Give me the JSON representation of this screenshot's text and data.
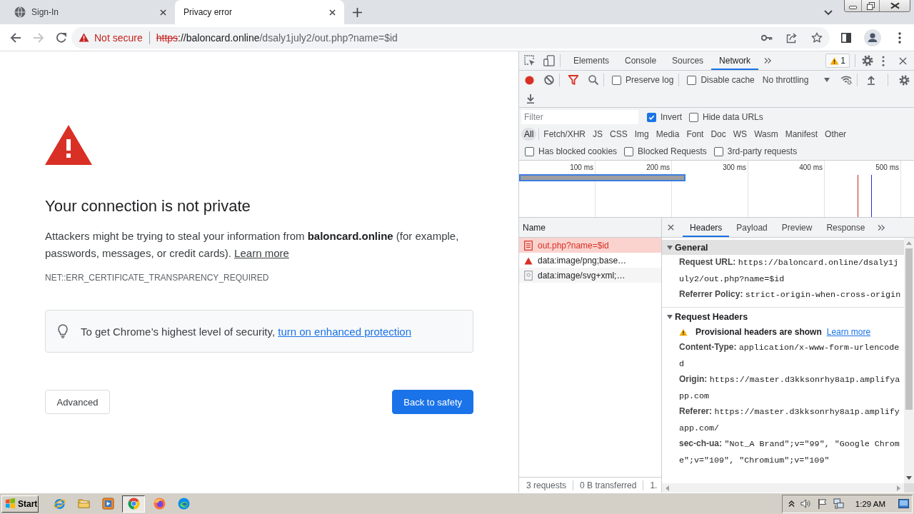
{
  "browser": {
    "tabs": [
      {
        "title": "Sign-In",
        "kind": "globe",
        "selected": false
      },
      {
        "title": "Privacy error",
        "selected": true
      }
    ],
    "nav": [
      {
        "kind": "back",
        "disabled": false
      },
      {
        "kind": "forward",
        "disabled": true
      },
      {
        "kind": "reload",
        "disabled": false
      }
    ],
    "address_bar": {
      "secure": false,
      "security_label": "Not secure",
      "scheme": "https",
      "host": "://baloncard.online",
      "path": "/dsaly1july2/out.php?name=$id"
    }
  },
  "page": {
    "heading": "Your connection is not private",
    "paragraph": {
      "text": "Attackers might be trying to steal your information from **baloncard.online** (for example, passwords, messages, or credit cards).",
      "link": "Learn more"
    },
    "error_code": "NET::ERR_CERTIFICATE_TRANSPARENCY_REQUIRED",
    "tip": {
      "text": "To get Chrome’s highest level of security,",
      "link": "turn on enhanced protection"
    },
    "buttons": [
      {
        "label": "Advanced",
        "kind": "secondary"
      },
      {
        "label": "Back to safety",
        "kind": "primary"
      }
    ]
  },
  "devtools": {
    "tabs": [
      {
        "label": "Elements",
        "selected": false
      },
      {
        "label": "Console",
        "selected": false
      },
      {
        "label": "Sources",
        "selected": false
      },
      {
        "label": "Network",
        "selected": true
      }
    ],
    "issues_count": "1",
    "recording": true,
    "filter_active": true,
    "options": [
      {
        "label": "Preserve log",
        "checked": false
      },
      {
        "label": "Disable cache",
        "checked": false
      }
    ],
    "throttling": "No throttling",
    "filter": {
      "placeholder": "Filter",
      "options": [
        {
          "label": "Invert",
          "checked": true
        },
        {
          "label": "Hide data URLs",
          "checked": false
        }
      ]
    },
    "type_filters": [
      {
        "label": "All",
        "selected": true
      },
      {
        "label": "Fetch/XHR",
        "selected": false
      },
      {
        "label": "JS",
        "selected": false
      },
      {
        "label": "CSS",
        "selected": false
      },
      {
        "label": "Img",
        "selected": false
      },
      {
        "label": "Media",
        "selected": false
      },
      {
        "label": "Font",
        "selected": false
      },
      {
        "label": "Doc",
        "selected": false
      },
      {
        "label": "WS",
        "selected": false
      },
      {
        "label": "Wasm",
        "selected": false
      },
      {
        "label": "Manifest",
        "selected": false
      },
      {
        "label": "Other",
        "selected": false
      }
    ],
    "request_filters": [
      {
        "label": "Has blocked cookies",
        "checked": false
      },
      {
        "label": "Blocked Requests",
        "checked": false
      },
      {
        "label": "3rd-party requests",
        "checked": false
      }
    ],
    "overview": {
      "ticks": [
        "100 ms",
        "200 ms",
        "300 ms",
        "400 ms",
        "500 ms"
      ]
    },
    "requests": {
      "column": "Name",
      "rows": [
        {
          "name": "out.php?name=$id",
          "kind": "document",
          "selected": true,
          "failed": true
        },
        {
          "name": "data:image/png;base…",
          "kind": "image",
          "selected": false,
          "failed": false
        },
        {
          "name": "data:image/svg+xml;…",
          "kind": "svg",
          "selected": false,
          "failed": false
        }
      ]
    },
    "summary": [
      "3 requests",
      "0 B transferred",
      "1."
    ],
    "details": {
      "tabs": [
        {
          "label": "Headers",
          "selected": true
        },
        {
          "label": "Payload",
          "selected": false
        },
        {
          "label": "Preview",
          "selected": false
        },
        {
          "label": "Response",
          "selected": false
        }
      ],
      "sections": [
        {
          "title": "General",
          "expanded": true,
          "highlighted": true,
          "rows": [
            {
              "key": "Request URL:",
              "value": "https://baloncard.online/dsaly1july2/out.php?name=$id"
            },
            {
              "key": "Referrer Policy:",
              "value": "strict-origin-when-cross-origin"
            }
          ]
        },
        {
          "title": "Request Headers",
          "expanded": true,
          "highlighted": false,
          "notice": {
            "text": "Provisional headers are shown",
            "link": "Learn more"
          },
          "rows": [
            {
              "key": "Content-Type:",
              "value": "application/x-www-form-urlencoded"
            },
            {
              "key": "Origin:",
              "value": "https://master.d3kksonrhy8a1p.amplifyapp.com"
            },
            {
              "key": "Referer:",
              "value": "https://master.d3kksonrhy8a1p.amplifyapp.com/"
            },
            {
              "key": "sec-ch-ua:",
              "value": "\"Not_A Brand\";v=\"99\", \"Google Chrome\";v=\"109\", \"Chromium\";v=\"109\""
            }
          ]
        }
      ]
    }
  },
  "taskbar": {
    "start": "Start",
    "apps": [
      {
        "kind": "ie",
        "active": false
      },
      {
        "kind": "folder",
        "active": false
      },
      {
        "kind": "media",
        "active": false
      },
      {
        "kind": "chrome",
        "active": true
      },
      {
        "kind": "firefox",
        "active": false
      },
      {
        "kind": "edge",
        "active": false
      }
    ],
    "clock": "1:29 AM"
  }
}
